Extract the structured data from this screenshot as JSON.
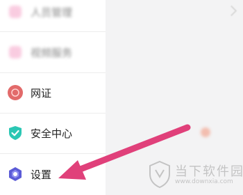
{
  "menu": {
    "items": [
      {
        "label": "人员管理",
        "icon": "pink-square-icon",
        "blurred": true
      },
      {
        "label": "视频服务",
        "icon": "pink-square-icon",
        "blurred": true
      },
      {
        "label": "网证",
        "icon": "id-badge-icon",
        "blurred": false
      },
      {
        "label": "安全中心",
        "icon": "shield-check-icon",
        "blurred": false
      },
      {
        "label": "设置",
        "icon": "hexagon-settings-icon",
        "blurred": false
      }
    ]
  },
  "watermark": {
    "title": "当下软件园",
    "url": "www.downxia.com"
  },
  "colors": {
    "arrow": "#e0407a",
    "id_badge": "#e26a6a",
    "shield": "#2bc7b4",
    "settings": "#5b5bd6"
  }
}
